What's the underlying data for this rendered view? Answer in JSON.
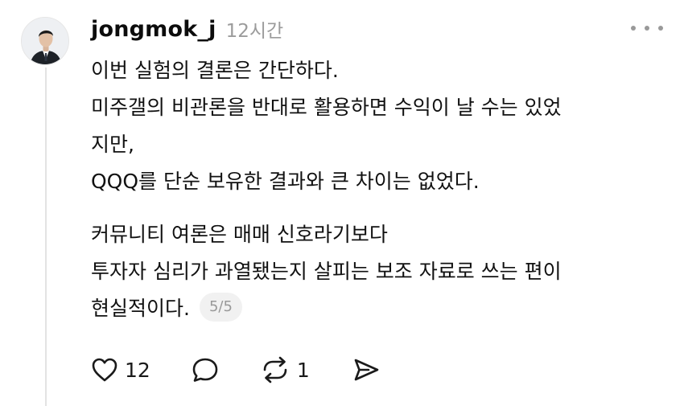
{
  "post": {
    "username": "jongmok_j",
    "timestamp": "12시간",
    "paragraphs": [
      {
        "lines": [
          "이번 실험의 결론은 간단하다.",
          "미주갤의 비관론을 반대로 활용하면 수익이 날 수는 있었",
          "지만,",
          "QQQ를 단순 보유한 결과와 큰 차이는 없었다."
        ]
      },
      {
        "lines": [
          "커뮤니티 여론은 매매 신호라기보다",
          "투자자 심리가 과열됐는지 살피는 보조 자료로 쓰는 편이",
          "현실적이다."
        ]
      }
    ],
    "page_indicator": "5/5"
  },
  "actions": {
    "like": {
      "icon": "heart-icon",
      "count": "12"
    },
    "comment": {
      "icon": "speech-bubble-icon"
    },
    "repost": {
      "icon": "repost-icon",
      "count": "1"
    },
    "share": {
      "icon": "send-icon"
    }
  },
  "more_menu": {
    "icon": "more-dots-icon"
  }
}
